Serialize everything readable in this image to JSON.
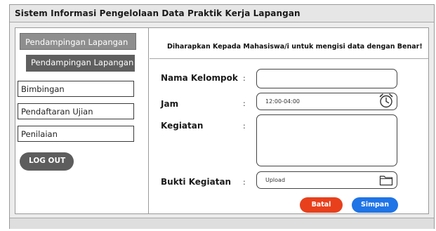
{
  "window": {
    "title": "Sistem Informasi Pengelolaan Data Praktik Kerja Lapangan"
  },
  "sidebar": {
    "header": "Pendampingan Lapangan",
    "active_item": "Pendampingan Lapangan",
    "items": [
      {
        "label": "Bimbingan"
      },
      {
        "label": "Pendaftaran Ujian"
      },
      {
        "label": "Penilaian"
      }
    ],
    "logout_label": "LOG OUT"
  },
  "main": {
    "instruction": "Diharapkan Kepada Mahasiswa/i untuk mengisi data dengan Benar!",
    "fields": [
      {
        "label": "Nama Kelompok",
        "colon": ":",
        "value": ""
      },
      {
        "label": "Jam",
        "colon": ":",
        "value": "12:00-04:00"
      },
      {
        "label": "Kegiatan",
        "colon": ":",
        "value": ""
      },
      {
        "label": "Bukti Kegiatan",
        "colon": ":",
        "value": "Upload"
      }
    ],
    "cancel_label": "Batal",
    "save_label": "Simpan"
  },
  "colors": {
    "cancel_button": "#e8401c",
    "save_button": "#1f74e6",
    "sidebar_header": "#8e8e8e",
    "sidebar_active": "#5f5f5f"
  },
  "icons": {
    "jam": "alarm-clock-icon",
    "bukti": "folder-icon"
  }
}
